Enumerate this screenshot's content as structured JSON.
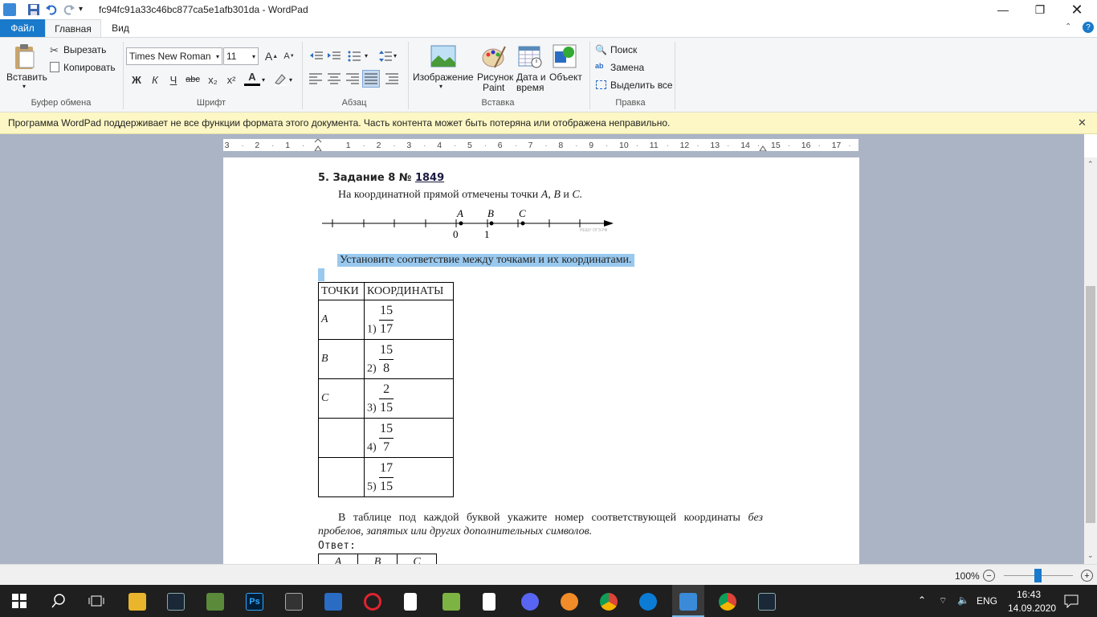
{
  "window": {
    "title": "fc94fc91a33c46bc877ca5e1afb301da - WordPad"
  },
  "tabs": {
    "file": "Файл",
    "home": "Главная",
    "view": "Вид"
  },
  "ribbon": {
    "clipboard": {
      "paste": "Вставить",
      "cut": "Вырезать",
      "copy": "Копировать",
      "group": "Буфер обмена"
    },
    "font": {
      "family": "Times New Roman",
      "size": "11",
      "group": "Шрифт",
      "bold": "Ж",
      "italic": "К",
      "underline": "Ч",
      "strike": "abc",
      "sub": "x₂",
      "sup": "x²",
      "color": "A"
    },
    "paragraph": {
      "group": "Абзац"
    },
    "insert": {
      "group": "Вставка",
      "image": "Изображение",
      "paint1": "Рисунок",
      "paint2": "Paint",
      "date1": "Дата и",
      "date2": "время",
      "object": "Объект"
    },
    "edit": {
      "group": "Правка",
      "find": "Поиск",
      "replace": "Замена",
      "select_all": "Выделить все"
    }
  },
  "infobar": {
    "message": "Программа WordPad поддерживает не все функции формата этого документа. Часть контента может быть потеряна или отображена неправильно."
  },
  "ruler": {
    "labels": [
      "3",
      "2",
      "1",
      "1",
      "2",
      "3",
      "4",
      "5",
      "6",
      "7",
      "8",
      "9",
      "10",
      "11",
      "12",
      "13",
      "14",
      "15",
      "16",
      "17"
    ]
  },
  "document": {
    "heading_prefix": "5. Задание  8 № ",
    "heading_link": "1849",
    "intro": "На координатной прямой отмечены точки ",
    "intro_points": "A, B",
    "intro_and": " и ",
    "intro_c": "C.",
    "numberline": {
      "point_a": "A",
      "point_b": "B",
      "point_c": "C",
      "zero": "0",
      "one": "1",
      "watermark": "РЕШУ ОГЭ.РФ"
    },
    "instruction": "Установите соответствие между точками и их координатами.",
    "table": {
      "head_points": "ТОЧКИ",
      "head_coords": "КООРДИНАТЫ",
      "rows": [
        {
          "point": "A",
          "num": "1)",
          "numerator": "15",
          "denominator": "17"
        },
        {
          "point": "B",
          "num": "2)",
          "numerator": "15",
          "denominator": "8"
        },
        {
          "point": "C",
          "num": "3)",
          "numerator": "2",
          "denominator": "15"
        },
        {
          "point": "",
          "num": "4)",
          "numerator": "15",
          "denominator": "7"
        },
        {
          "point": "",
          "num": "5)",
          "numerator": "17",
          "denominator": "15"
        }
      ]
    },
    "task_text": "В таблице под каждой буквой укажите номер соответствующей координаты ",
    "task_italic": "без пробелов, запятых или других дополнительных символов.",
    "answer_label": "Ответ:",
    "answer_cols": [
      "A",
      "B",
      "C"
    ]
  },
  "status": {
    "zoom": "100%"
  },
  "taskbar": {
    "lang": "ENG",
    "time": "16:43",
    "date": "14.09.2020"
  },
  "colors": {
    "accent": "#1979ca",
    "infobar": "#fcf7c4",
    "selection": "#99c9ef"
  }
}
